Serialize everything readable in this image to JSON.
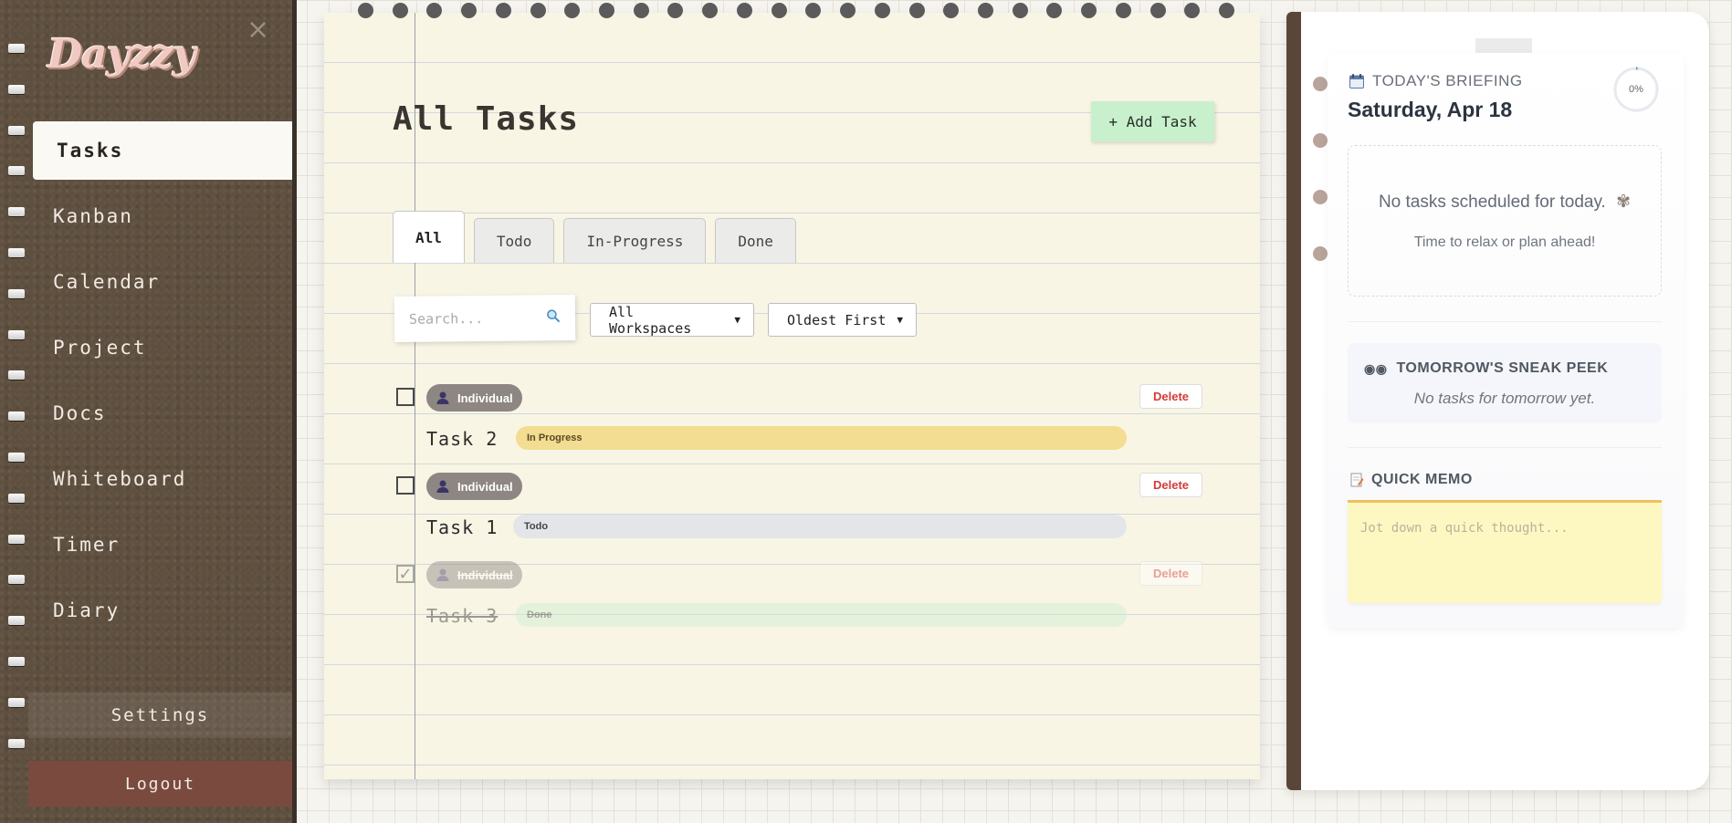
{
  "app": {
    "logo": "Dayzzy",
    "close_glyph": "×"
  },
  "sidebar": {
    "items": [
      {
        "label": "Tasks",
        "active": true
      },
      {
        "label": "Kanban"
      },
      {
        "label": "Calendar"
      },
      {
        "label": "Project"
      },
      {
        "label": "Docs"
      },
      {
        "label": "Whiteboard"
      },
      {
        "label": "Timer"
      },
      {
        "label": "Diary"
      }
    ],
    "settings_label": "Settings",
    "logout_label": "Logout"
  },
  "main": {
    "title": "All Tasks",
    "add_task_label": "+ Add Task",
    "tabs": [
      {
        "label": "All",
        "active": true
      },
      {
        "label": "Todo"
      },
      {
        "label": "In-Progress"
      },
      {
        "label": "Done"
      }
    ],
    "search": {
      "placeholder": "Search...",
      "icon": "search-icon"
    },
    "workspace_filter": {
      "selected": "All Workspaces"
    },
    "sort": {
      "selected": "Oldest First"
    },
    "tasks": [
      {
        "title": "Task 2",
        "workspace": "Individual",
        "status": "In Progress",
        "status_color": "#f3dd92",
        "done": false
      },
      {
        "title": "Task 1",
        "workspace": "Individual",
        "status": "Todo",
        "status_color": "#e4e5e8",
        "done": false
      },
      {
        "title": "Task 3",
        "workspace": "Individual",
        "status": "Done",
        "status_color": "#cdeed0",
        "done": true
      }
    ],
    "delete_label": "Delete"
  },
  "briefing": {
    "label": "TODAY'S BRIEFING",
    "date": "Saturday, Apr 18",
    "progress": "0%",
    "empty_title": "No tasks scheduled for today.",
    "empty_sub": "Time to relax or plan ahead!",
    "peek_title": "TOMORROW'S SNEAK PEEK",
    "peek_text": "No tasks for tomorrow yet.",
    "memo_title": "QUICK MEMO",
    "memo_placeholder": "Jot down a quick thought..."
  }
}
